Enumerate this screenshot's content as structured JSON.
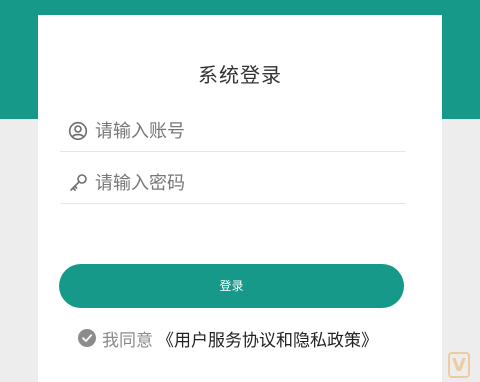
{
  "colors": {
    "accent": "#17998a",
    "background": "#ededed",
    "card": "#ffffff"
  },
  "login": {
    "title": "系统登录",
    "account": {
      "icon": "user-circle-icon",
      "placeholder": "请输入账号",
      "value": ""
    },
    "password": {
      "icon": "key-icon",
      "placeholder": "请输入密码",
      "value": ""
    },
    "submit_label": "登录",
    "agreement": {
      "checked": true,
      "icon": "check-circle-icon",
      "text": "我同意",
      "link_text": "《用户服务协议和隐私政策》"
    }
  },
  "watermark": {
    "logo_text": "V"
  }
}
